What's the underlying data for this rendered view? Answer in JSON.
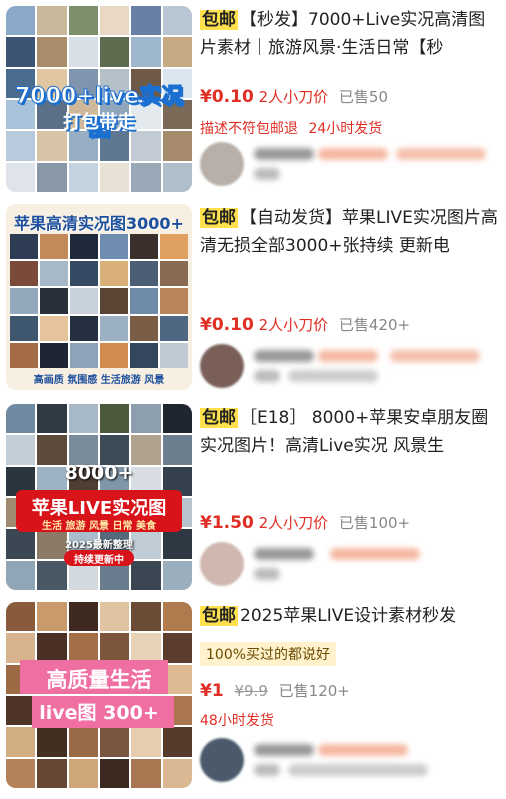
{
  "products": [
    {
      "thumb_overlay": "7000+live实况图",
      "thumb_overlay_2": "打包带走",
      "badge": "包邮",
      "title": "【秒发】7000+Live实况高清图片素材｜旅游风景·生活日常【秒",
      "currency": "¥",
      "price": "0.10",
      "bargain": "2人小刀价",
      "sold": "已售50",
      "tags": [
        "描述不符包邮退",
        "24小时发货"
      ]
    },
    {
      "thumb_overlay": "苹果高清实况图3000+",
      "thumb_overlay_2": "高画质 氛围感 生活旅游 风景",
      "badge": "包邮",
      "title": "【自动发货】苹果LIVE实况图片高清无损全部3000+张持续 更新电",
      "currency": "¥",
      "price": "0.10",
      "bargain": "2人小刀价",
      "sold": "已售420+"
    },
    {
      "thumb_overlay": "8000+",
      "thumb_overlay_2": "苹果LIVE实况图",
      "thumb_overlay_3": "生活 旅游 风景 日常 美食",
      "thumb_overlay_4": "2025最新整理",
      "thumb_overlay_5": "持续更新中",
      "badge": "包邮",
      "title": "［E18］ 8000+苹果安卓朋友圈实况图片！高清Live实况 风景生",
      "currency": "¥",
      "price": "1.50",
      "bargain": "2人小刀价",
      "sold": "已售100+"
    },
    {
      "thumb_overlay": "高质量生活",
      "thumb_overlay_2": "live图 300+",
      "badge": "包邮",
      "title": "2025苹果LIVE设计素材秒发",
      "highlight": "100%买过的都说好",
      "currency": "¥",
      "price": "1",
      "original_price": "¥9.9",
      "sold": "已售120+",
      "tags": [
        "48小时发货"
      ]
    }
  ],
  "colors": {
    "price_red": "#e02e24",
    "badge_yellow": "#ffe14d"
  }
}
